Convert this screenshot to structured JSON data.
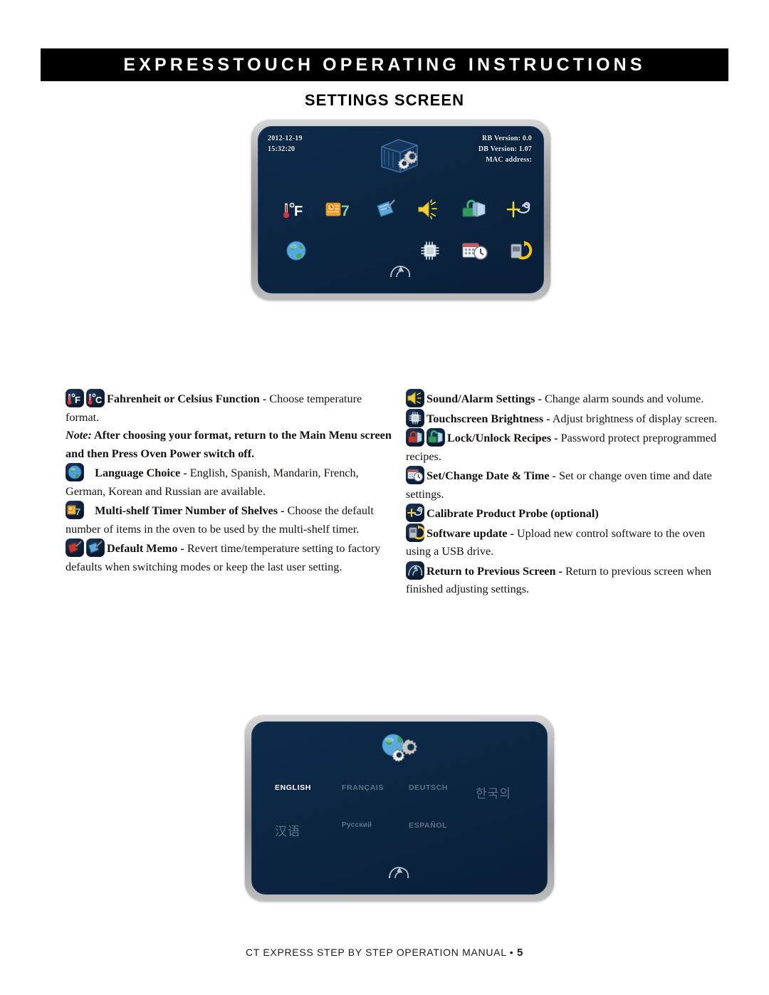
{
  "header": {
    "banner_title": "EXPRESSTOUCH OPERATING INSTRUCTIONS",
    "page_subtitle": "SETTINGS SCREEN"
  },
  "settings_screen": {
    "date": "2012-12-19",
    "time": "15:32:20",
    "rb_version": "RB Version: 0.0",
    "db_version": "DB Version: 1.07",
    "mac_address": "MAC address:",
    "header_icon": "oven-gears-icon",
    "icons_row1": [
      "fahrenheit-celsius-icon",
      "multi-shelf-timer-icon",
      "default-memo-icon",
      "sound-alarm-icon",
      "lock-unlock-recipes-icon",
      "calibrate-probe-icon"
    ],
    "icons_row2": [
      "language-globe-icon",
      "",
      "",
      "touchscreen-brightness-icon",
      "date-time-icon",
      "software-update-icon"
    ],
    "back_icon": "return-previous-screen-icon",
    "shelf_count": "7",
    "temp_unit": "°F"
  },
  "language_screen": {
    "header_icon": "globe-gear-icon",
    "languages": [
      {
        "label": "ENGLISH",
        "selected": true,
        "script": "latin"
      },
      {
        "label": "FRANÇAIS",
        "selected": false,
        "script": "latin"
      },
      {
        "label": "DEUTSCH",
        "selected": false,
        "script": "latin"
      },
      {
        "label": "한국의",
        "selected": false,
        "script": "cjk"
      },
      {
        "label": "汉语",
        "selected": false,
        "script": "cjk"
      },
      {
        "label": "Русский",
        "selected": false,
        "script": "cyrillic"
      },
      {
        "label": "ESPAÑOL",
        "selected": false,
        "script": "latin"
      }
    ],
    "back_icon": "return-previous-screen-icon"
  },
  "descriptions": {
    "left": [
      {
        "icons": [
          "fahrenheit-icon",
          "celsius-icon"
        ],
        "title": "Fahrenheit or Celsius Function -",
        "body": " Choose temperature format.",
        "note_label": "Note:",
        "note_text": " After choosing your format, return to the Main Menu screen and then Press Oven Power switch off."
      },
      {
        "icons": [
          "language-globe-icon"
        ],
        "title": "Language Choice -",
        "body": " English, Spanish, Mandarin, French, German, Korean and Russian are available."
      },
      {
        "icons": [
          "multi-shelf-timer-icon"
        ],
        "title": "Multi-shelf Timer Number of Shelves -",
        "body": " Choose the default number of items in the oven to be used by the multi-shelf timer."
      },
      {
        "icons": [
          "default-memo-locked-icon",
          "default-memo-icon"
        ],
        "title": "Default Memo -",
        "body": " Revert time/temperature setting to factory defaults when switching modes or keep the last user setting."
      }
    ],
    "right": [
      {
        "icons": [
          "sound-alarm-icon"
        ],
        "title": "Sound/Alarm Settings -",
        "body": " Change alarm sounds and volume."
      },
      {
        "icons": [
          "touchscreen-brightness-icon"
        ],
        "title": "Touchscreen Brightness -",
        "body": " Adjust brightness of display screen."
      },
      {
        "icons": [
          "lock-recipes-icon",
          "unlock-recipes-icon"
        ],
        "title": "Lock/Unlock Recipes -",
        "body": " Password protect preprogrammed recipes."
      },
      {
        "icons": [
          "date-time-icon"
        ],
        "title": "Set/Change Date & Time -",
        "body": " Set or change oven time and date settings."
      },
      {
        "icons": [
          "calibrate-probe-icon"
        ],
        "title": "Calibrate Product Probe (optional)",
        "body": ""
      },
      {
        "icons": [
          "software-update-icon"
        ],
        "title": "Software update -",
        "body": " Upload new control software to the oven using a USB drive."
      },
      {
        "icons": [
          "return-previous-screen-icon"
        ],
        "title": "Return to Previous Screen -",
        "body": " Return to previous screen when finished adjusting settings."
      }
    ]
  },
  "footer": {
    "text": "CT EXPRESS STEP BY STEP OPERATION MANUAL •",
    "page_number": "5"
  },
  "colors": {
    "banner_bg": "#000000",
    "screen_bg": "#0b2440",
    "bezel": "#a9a9a9",
    "selected_language": "#ffffff",
    "dim_language": "#5f7284"
  }
}
